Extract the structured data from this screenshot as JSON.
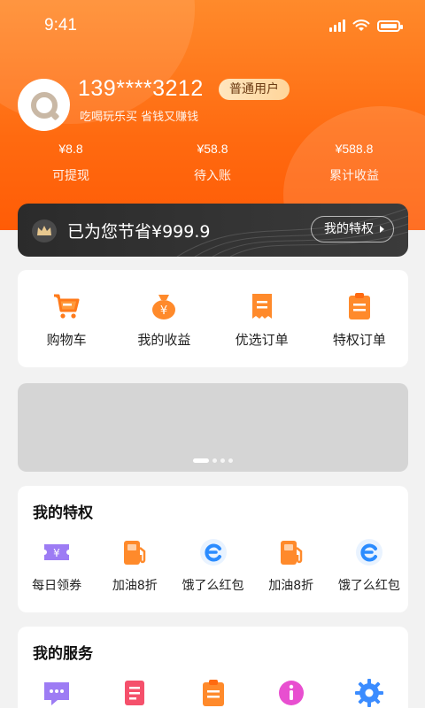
{
  "status": {
    "time": "9:41"
  },
  "user": {
    "phone": "139****3212",
    "level": "普通用户",
    "slogan": "吃喝玩乐买  省钱又赚钱"
  },
  "stats": [
    {
      "value": "¥8.8",
      "label": "可提现"
    },
    {
      "value": "¥58.8",
      "label": "待入账"
    },
    {
      "value": "¥588.8",
      "label": "累计收益"
    }
  ],
  "savings": {
    "text": "已为您节省¥999.9",
    "button": "我的特权"
  },
  "quick": [
    {
      "label": "购物车",
      "icon": "cart-icon"
    },
    {
      "label": "我的收益",
      "icon": "money-bag-icon"
    },
    {
      "label": "优选订单",
      "icon": "order-icon"
    },
    {
      "label": "特权订单",
      "icon": "clipboard-icon"
    }
  ],
  "privileges": {
    "title": "我的特权",
    "items": [
      {
        "label": "每日领券",
        "icon": "coupon-icon"
      },
      {
        "label": "加油8折",
        "icon": "fuel-icon"
      },
      {
        "label": "饿了么红包",
        "icon": "eleme-icon"
      },
      {
        "label": "加油8折",
        "icon": "fuel-icon"
      },
      {
        "label": "饿了么红包",
        "icon": "eleme-icon"
      }
    ]
  },
  "services": {
    "title": "我的服务",
    "items": [
      {
        "icon": "chat-icon"
      },
      {
        "icon": "list-icon"
      },
      {
        "icon": "clipboard-icon"
      },
      {
        "icon": "info-icon"
      },
      {
        "icon": "gear-icon"
      }
    ]
  },
  "colors": {
    "brand": "#ff6a10",
    "gold": "#ffd59a",
    "dark": "#2b2b2b"
  }
}
